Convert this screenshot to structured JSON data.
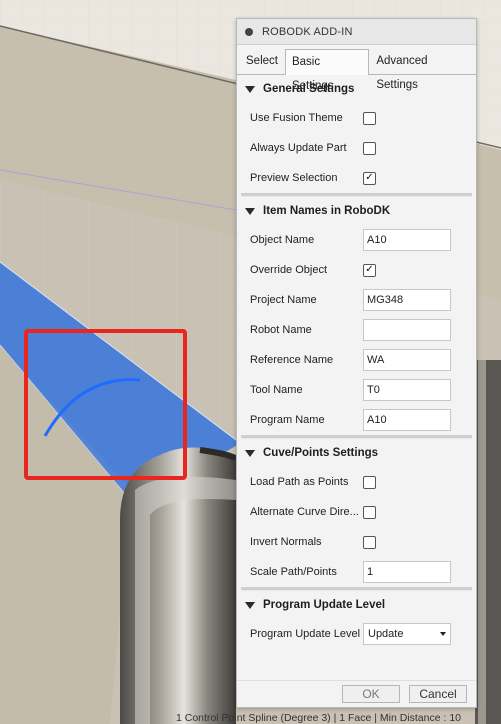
{
  "dialog": {
    "title": "ROBODK ADD-IN",
    "tabs": [
      "Select",
      "Basic Settings",
      "Advanced Settings"
    ],
    "active_tab": "Basic Settings"
  },
  "general": {
    "title": "General Settings",
    "use_fusion_theme": {
      "label": "Use Fusion Theme",
      "checked": false
    },
    "always_update_part": {
      "label": "Always Update Part",
      "checked": false
    },
    "preview_selection": {
      "label": "Preview Selection",
      "checked": true
    }
  },
  "item_names": {
    "title": "Item Names in RoboDK",
    "object_name": {
      "label": "Object Name",
      "value": "A10"
    },
    "override_object": {
      "label": "Override Object",
      "checked": true
    },
    "project_name": {
      "label": "Project Name",
      "value": "MG348"
    },
    "robot_name": {
      "label": "Robot Name",
      "value": ""
    },
    "reference_name": {
      "label": "Reference Name",
      "value": "WA"
    },
    "tool_name": {
      "label": "Tool Name",
      "value": "T0"
    },
    "program_name": {
      "label": "Program Name",
      "value": "A10"
    }
  },
  "curve_points": {
    "title": "Cuve/Points Settings",
    "load_path_as_points": {
      "label": "Load Path as Points",
      "checked": false
    },
    "alternate_curve_dir": {
      "label": "Alternate Curve Dire...",
      "checked": false
    },
    "invert_normals": {
      "label": "Invert Normals",
      "checked": false
    },
    "scale_path_points": {
      "label": "Scale Path/Points",
      "value": "1"
    }
  },
  "program_update": {
    "title": "Program Update Level",
    "level": {
      "label": "Program Update Level",
      "value": "Update"
    }
  },
  "footer": {
    "ok_label": "OK",
    "cancel_label": "Cancel"
  },
  "status_text": "1 Control Point Spline (Degree 3) | 1 Face | Min Distance : 10",
  "colors": {
    "selection_face": "#4a7fd6",
    "highlight_box": "#e8261d",
    "curve": "#1f6dff"
  },
  "icons": {
    "check": "check-icon",
    "triangle": "triangle-down-icon",
    "caret": "dropdown-caret-icon"
  }
}
